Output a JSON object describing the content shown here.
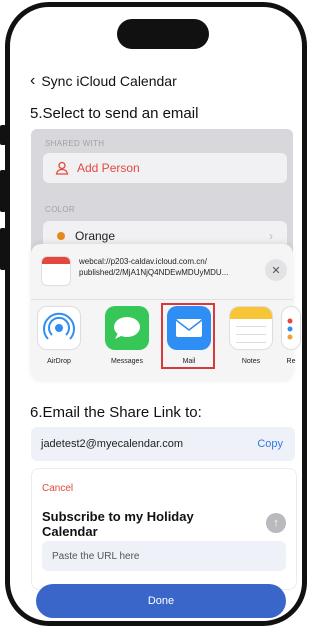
{
  "nav": {
    "back_icon": "chevron-left-icon",
    "title": "Sync iCloud Calendar"
  },
  "step5": {
    "title": "5.Select to send an email"
  },
  "settings": {
    "shared_with_label": "SHARED WITH",
    "add_person": "Add Person",
    "color_label": "COLOR",
    "color_value": "Orange",
    "color_hex": "#e58a1c"
  },
  "share_sheet": {
    "url_line1": "webcal://p203-caldav.icloud.com.cn/",
    "url_line2": "published/2/MjA1NjQ4NDEwMDUyMDU...",
    "apps": [
      {
        "label": "AirDrop",
        "icon": "airdrop-icon"
      },
      {
        "label": "Messages",
        "icon": "messages-icon",
        "color": "#37c759"
      },
      {
        "label": "Mail",
        "icon": "mail-icon",
        "color": "#2f8ef4"
      },
      {
        "label": "Notes",
        "icon": "notes-icon"
      },
      {
        "label": "Re",
        "icon": "reminders-icon"
      }
    ],
    "highlight_color": "#d63a3a"
  },
  "step6": {
    "title": "6.Email the Share Link to:"
  },
  "email": {
    "address": "jadetest2@myecalendar.com",
    "copy_label": "Copy"
  },
  "compose": {
    "cancel_label": "Cancel",
    "subject": "Subscribe to my Holiday Calendar",
    "paste_placeholder": "Paste the URL here"
  },
  "done_label": "Done",
  "accent_color": "#3a66c9"
}
